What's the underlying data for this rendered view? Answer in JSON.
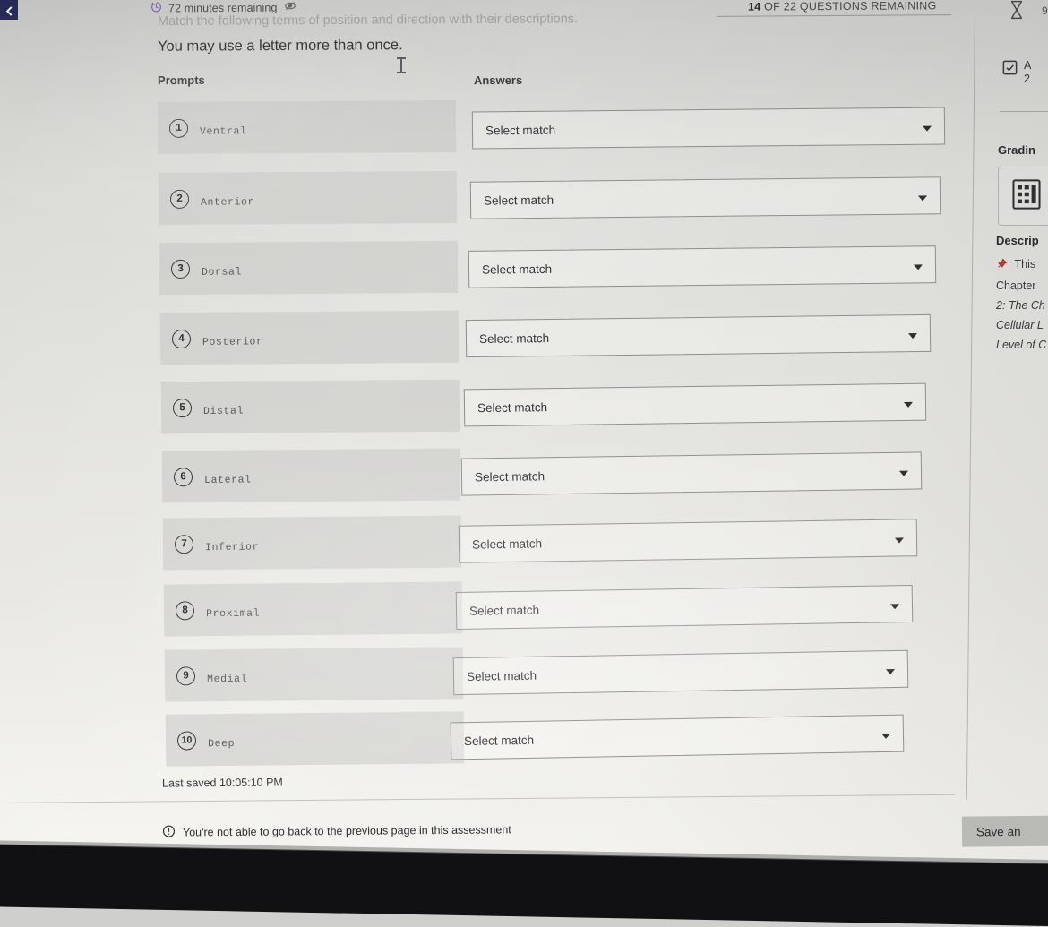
{
  "header": {
    "timer_icon": "clock-icon",
    "timer_text": "72 minutes remaining",
    "hide_timer_icon": "eye-off-icon",
    "question_counter_prefix": "14",
    "question_counter_suffix": " OF 22 QUESTIONS REMAINING",
    "hourglass_icon": "hourglass-icon",
    "right_number": "9"
  },
  "question": {
    "stem_partial": "Match the following terms of position and direction with their descriptions.",
    "instruction": "You may use a letter more than once.",
    "prompts_header": "Prompts",
    "answers_header": "Answers"
  },
  "rows": [
    {
      "number": "1",
      "label": "Ventral",
      "answer": "Select match"
    },
    {
      "number": "2",
      "label": "Anterior",
      "answer": "Select match"
    },
    {
      "number": "3",
      "label": "Dorsal",
      "answer": "Select match"
    },
    {
      "number": "4",
      "label": "Posterior",
      "answer": "Select match"
    },
    {
      "number": "5",
      "label": "Distal",
      "answer": "Select match"
    },
    {
      "number": "6",
      "label": "Lateral",
      "answer": "Select match"
    },
    {
      "number": "7",
      "label": "Inferior",
      "answer": "Select match"
    },
    {
      "number": "8",
      "label": "Proximal",
      "answer": "Select match"
    },
    {
      "number": "9",
      "label": "Medial",
      "answer": "Select match"
    },
    {
      "number": "10",
      "label": "Deep",
      "answer": "Select match"
    }
  ],
  "footer": {
    "last_saved": "Last saved 10:05:10 PM",
    "warning_icon": "exclamation-circle-icon",
    "warning_text": "You're not able to go back to the previous page in this assessment",
    "save_button_label": "Save an"
  },
  "sidebar": {
    "attempt_icon": "checkbox-checked-icon",
    "attempt_line1": "A",
    "attempt_line2": "2",
    "grading_title": "Gradin",
    "calculator_icon": "calculator-icon",
    "description_title": "Descrip",
    "pin_icon": "pushpin-icon",
    "desc_line1": "This",
    "desc_line2": "Chapter",
    "desc_line3": "2: The Ch",
    "desc_line4": "Cellular L",
    "desc_line5": "Level of C"
  },
  "nav": {
    "back_tab_icon": "chevron-left-icon"
  },
  "colors": {
    "navy": "#252a5c",
    "pin_red": "#c0392b",
    "bezel": "#111113"
  }
}
